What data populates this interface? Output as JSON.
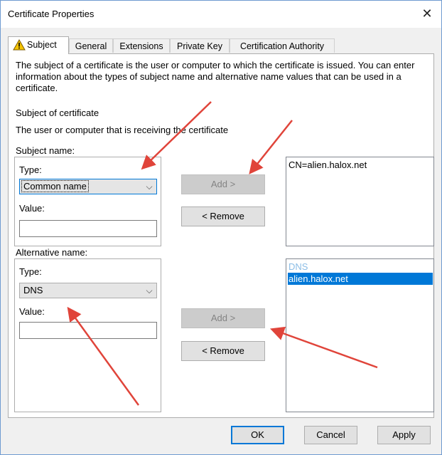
{
  "window": {
    "title": "Certificate Properties",
    "close_glyph": "✕"
  },
  "tabs": [
    {
      "label": "Subject",
      "icon": "warning-icon"
    },
    {
      "label": "General"
    },
    {
      "label": "Extensions"
    },
    {
      "label": "Private Key"
    },
    {
      "label": "Certification Authority"
    }
  ],
  "subject_tab": {
    "intro": "The subject of a certificate is the user or computer to which the certificate is issued. You can enter information about the types of subject name and alternative name values that can be used in a certificate.",
    "section_heading": "Subject of certificate",
    "section_desc": "The user or computer that is receiving the certificate",
    "subject_name": {
      "label": "Subject name:",
      "type_label": "Type:",
      "type_value": "Common name",
      "value_label": "Value:",
      "value": ""
    },
    "alternative_name": {
      "label": "Alternative name:",
      "type_label": "Type:",
      "type_value": "DNS",
      "value_label": "Value:",
      "value": ""
    },
    "buttons": {
      "add": "Add >",
      "remove": "< Remove"
    },
    "subject_list": [
      "CN=alien.halox.net"
    ],
    "alternative_list": {
      "header": "DNS",
      "items": [
        "alien.halox.net"
      ]
    }
  },
  "footer": {
    "ok": "OK",
    "cancel": "Cancel",
    "apply": "Apply"
  },
  "colors": {
    "accent": "#0078d7",
    "annotation_arrow": "#e0443a",
    "warning": "#f5c400"
  }
}
